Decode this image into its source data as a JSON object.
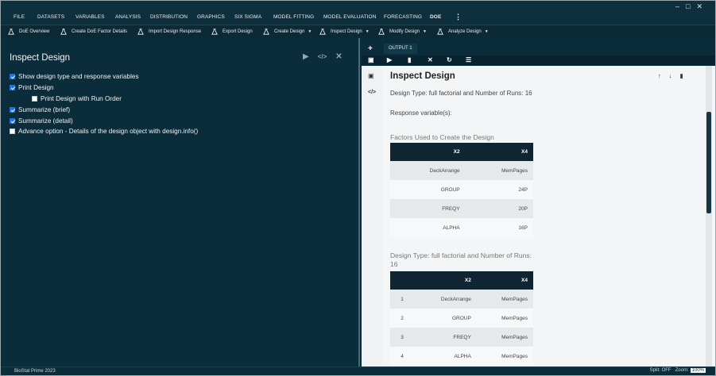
{
  "menubar": {
    "items": [
      "FILE",
      "DATASETS",
      "VARIABLES",
      "ANALYSIS",
      "DISTRIBUTION",
      "GRAPHICS",
      "SIX SIGMA",
      "MODEL FITTING",
      "MODEL EVALUATION",
      "FORECASTING",
      "DOE"
    ],
    "active": "DOE",
    "more_icon": "vertical-ellipsis-icon",
    "window_controls": [
      "minimize-icon",
      "maximize-icon",
      "close-icon"
    ]
  },
  "toolbar": {
    "items": [
      {
        "label": "DoE Overview",
        "icon": "flask-icon",
        "dropdown": false
      },
      {
        "label": "Create DoE Factor Details",
        "icon": "flask-icon",
        "dropdown": false
      },
      {
        "label": "Import Design Response",
        "icon": "flask-icon",
        "dropdown": false
      },
      {
        "label": "Export Design",
        "icon": "flask-icon",
        "dropdown": false
      },
      {
        "label": "Create Design",
        "icon": "flask-icon",
        "dropdown": true
      },
      {
        "label": "Inspect Design",
        "icon": "flask-icon",
        "dropdown": true
      },
      {
        "label": "Modify Design",
        "icon": "flask-icon",
        "dropdown": true
      },
      {
        "label": "Analyze Design",
        "icon": "flask-icon",
        "dropdown": true
      }
    ]
  },
  "left_panel": {
    "title": "Inspect Design",
    "actions": [
      "run-icon",
      "code-icon",
      "close-icon"
    ],
    "options": [
      {
        "label": "Show design type and response variables",
        "checked": true,
        "indent": false
      },
      {
        "label": "Print Design",
        "checked": true,
        "indent": false
      },
      {
        "label": "Print Design with Run Order",
        "checked": false,
        "indent": true
      },
      {
        "label": "Summarize (brief)",
        "checked": true,
        "indent": false
      },
      {
        "label": "Summarize (detail)",
        "checked": true,
        "indent": false
      },
      {
        "label": "Advance option - Details of the design object with design.info()",
        "checked": false,
        "indent": false
      }
    ]
  },
  "output": {
    "tab_label": "OUTPUT 1",
    "toolbar_icons": [
      "save-icon",
      "export-icon",
      "delete-icon",
      "close-icon",
      "refresh-icon",
      "list-icon"
    ],
    "title": "Inspect Design",
    "header_actions": [
      "arrow-up-icon",
      "arrow-down-icon",
      "trash-icon"
    ],
    "design_type_text": "Design Type: full factorial and Number of Runs: 16",
    "response_text": "Response variable(s):",
    "factors_heading": "Factors Used to Create the Design",
    "factors_table": {
      "headers": [
        "X2",
        "X4"
      ],
      "rows": [
        [
          "DeckArrange",
          "MemPages"
        ],
        [
          "GROUP",
          "24P"
        ],
        [
          "FREQY",
          "20P"
        ],
        [
          "ALPHA",
          "16P"
        ]
      ]
    },
    "design_heading": "Design Type: full factorial and Number of Runs: 16",
    "design_table": {
      "headers": [
        "",
        "X2",
        "X4"
      ],
      "rows": [
        [
          "1",
          "DeckArrange",
          "MemPages"
        ],
        [
          "2",
          "GROUP",
          "MemPages"
        ],
        [
          "3",
          "FREQY",
          "MemPages"
        ],
        [
          "4",
          "ALPHA",
          "MemPages"
        ]
      ]
    }
  },
  "status": {
    "app": "BioStat Prime 2023",
    "split": "Split: OFF",
    "zoom_label": "Zoom:",
    "zoom_value": "100%"
  }
}
